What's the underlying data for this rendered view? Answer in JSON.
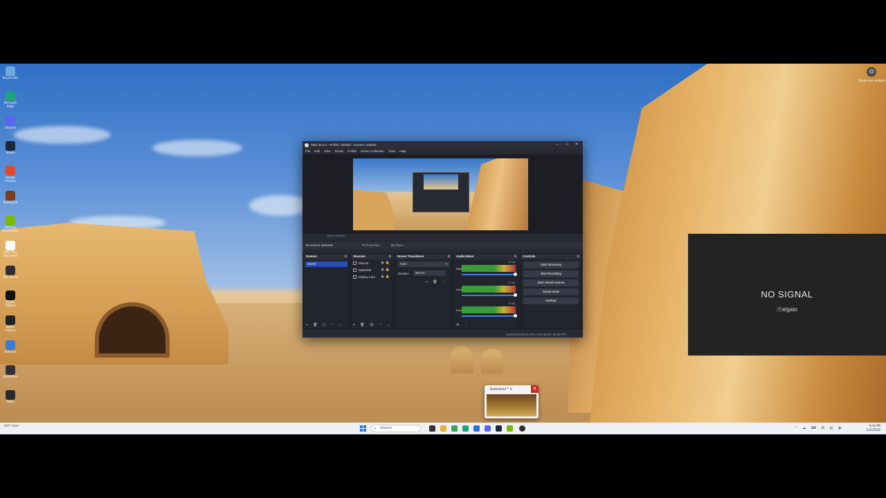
{
  "desktop": {
    "icons": [
      {
        "label": "Recycle Bin",
        "icon": "recycle-bin-icon",
        "color": "#6fa8dc"
      },
      {
        "label": "Microsoft Edge",
        "icon": "edge-icon",
        "color": "#1fa37a"
      },
      {
        "label": "Discord",
        "icon": "discord-icon",
        "color": "#5865f2"
      },
      {
        "label": "Steam",
        "icon": "steam-icon",
        "color": "#1b2838"
      },
      {
        "label": "Google Chrome",
        "icon": "chrome-icon",
        "color": "#e2492f"
      },
      {
        "label": "Battlefield",
        "icon": "game-icon",
        "color": "#7a3b1e"
      },
      {
        "label": "GeForce Experience",
        "icon": "nvidia-icon",
        "color": "#76b900"
      },
      {
        "label": "New Text Document",
        "icon": "document-icon",
        "color": "#ffffff"
      },
      {
        "label": "OBS Studio",
        "icon": "obs-icon",
        "color": "#302e31"
      },
      {
        "label": "Elgato Capture",
        "icon": "capture-icon",
        "color": "#111111"
      },
      {
        "label": "Elgato Capture",
        "icon": "capture-icon",
        "color": "#222222"
      },
      {
        "label": "Notepad",
        "icon": "notepad-icon",
        "color": "#3a7bd5"
      },
      {
        "label": "Battlefield",
        "icon": "game-icon",
        "color": "#333333"
      },
      {
        "label": "Power",
        "icon": "power-icon",
        "color": "#2a2a2a"
      }
    ],
    "corner_label": "Show more widgets"
  },
  "capture_overlay": {
    "message": "NO SIGNAL",
    "brand": "elgato"
  },
  "obs": {
    "title": "OBS 32.0.4 - Profile: Untitled - Scenes: Untitled",
    "menu": [
      "File",
      "Edit",
      "View",
      "Docks",
      "Profile",
      "Scene Collection",
      "Tools",
      "Help"
    ],
    "preview_status": "Scale to Window",
    "no_source": "No source selected",
    "properties": "Properties",
    "filters": "Filters",
    "docks": {
      "scenes": {
        "title": "Scenes",
        "items": [
          "Scene"
        ]
      },
      "sources": {
        "title": "Sources",
        "items": [
          "Discord",
          "Battlefield",
          "Display Capt"
        ]
      },
      "transitions": {
        "title": "Scene Transitions",
        "selected": "Fade",
        "duration_label": "Duration",
        "duration_value": "300 ms"
      },
      "mixer": {
        "title": "Audio Mixer",
        "channels": [
          {
            "name": "Battlefield",
            "db": "0.0 dB"
          },
          {
            "name": "Desktop Audio",
            "db": "0.0 dB"
          },
          {
            "name": "Discord",
            "db": "0.0 dB"
          }
        ]
      },
      "controls": {
        "title": "Controls",
        "buttons": [
          "Start Streaming",
          "Start Recording",
          "Start Virtual Camera",
          "Studio Mode",
          "Settings"
        ]
      }
    },
    "status_bar": "00:00:00   00:00:00   CPU: 0.9%   60.00 / 60.00 FPS"
  },
  "thumbnail": {
    "title": "Battlefield™ 6"
  },
  "taskbar": {
    "weather": "83°F Clear",
    "search": "Search",
    "time": "9:16 PM",
    "date": "2/23/2026"
  }
}
